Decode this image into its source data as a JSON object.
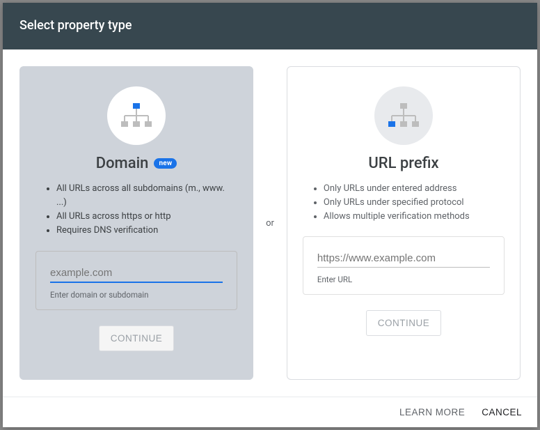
{
  "header": {
    "title": "Select property type"
  },
  "separator": "or",
  "domain_card": {
    "title": "Domain",
    "badge": "new",
    "bullets": [
      "All URLs across all subdomains (m., www. ...)",
      "All URLs across https or http",
      "Requires DNS verification"
    ],
    "placeholder": "example.com",
    "helper": "Enter domain or subdomain",
    "continue": "CONTINUE"
  },
  "url_card": {
    "title": "URL prefix",
    "bullets": [
      "Only URLs under entered address",
      "Only URLs under specified protocol",
      "Allows multiple verification methods"
    ],
    "placeholder": "https://www.example.com",
    "helper": "Enter URL",
    "continue": "CONTINUE"
  },
  "footer": {
    "learn_more": "LEARN MORE",
    "cancel": "CANCEL"
  }
}
